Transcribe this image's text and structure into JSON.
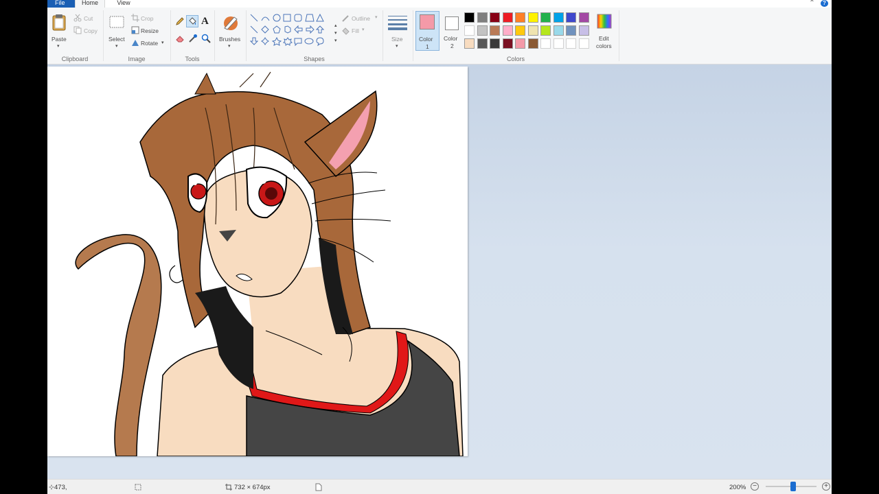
{
  "menu": {
    "file": "File",
    "home": "Home",
    "view": "View"
  },
  "clipboard": {
    "paste": "Paste",
    "cut": "Cut",
    "copy": "Copy",
    "label": "Clipboard"
  },
  "image": {
    "select": "Select",
    "crop": "Crop",
    "resize": "Resize",
    "rotate": "Rotate",
    "label": "Image"
  },
  "tools": {
    "label": "Tools"
  },
  "brushes": {
    "label": "Brushes"
  },
  "shapes": {
    "outline": "Outline",
    "fill": "Fill",
    "label": "Shapes"
  },
  "size": {
    "label": "Size"
  },
  "colors": {
    "color1": "Color",
    "color1_num": "1",
    "color2": "Color",
    "color2_num": "2",
    "edit": "Edit",
    "edit2": "colors",
    "label": "Colors",
    "color1_value": "#f49aa8",
    "color2_value": "#ffffff",
    "palette_row1": [
      "#000000",
      "#7f7f7f",
      "#880015",
      "#ed1c24",
      "#ff7f27",
      "#fff200",
      "#22b14c",
      "#00a2e8",
      "#3f48cc",
      "#a349a4"
    ],
    "palette_row2": [
      "#ffffff",
      "#c3c3c3",
      "#b97a57",
      "#ffaec9",
      "#ffc90e",
      "#efe4b0",
      "#b5e61d",
      "#99d9ea",
      "#7092be",
      "#c8bfe7"
    ],
    "palette_row3": [
      "#f8dcc0",
      "#585858",
      "#3a3a3a",
      "#7a1022",
      "#f49aa8",
      "#8a5a34",
      "#ffffff",
      "#ffffff",
      "#ffffff",
      "#ffffff"
    ]
  },
  "status": {
    "cursor_pos": "473,",
    "image_size": "732 × 674px",
    "zoom": "200%"
  }
}
